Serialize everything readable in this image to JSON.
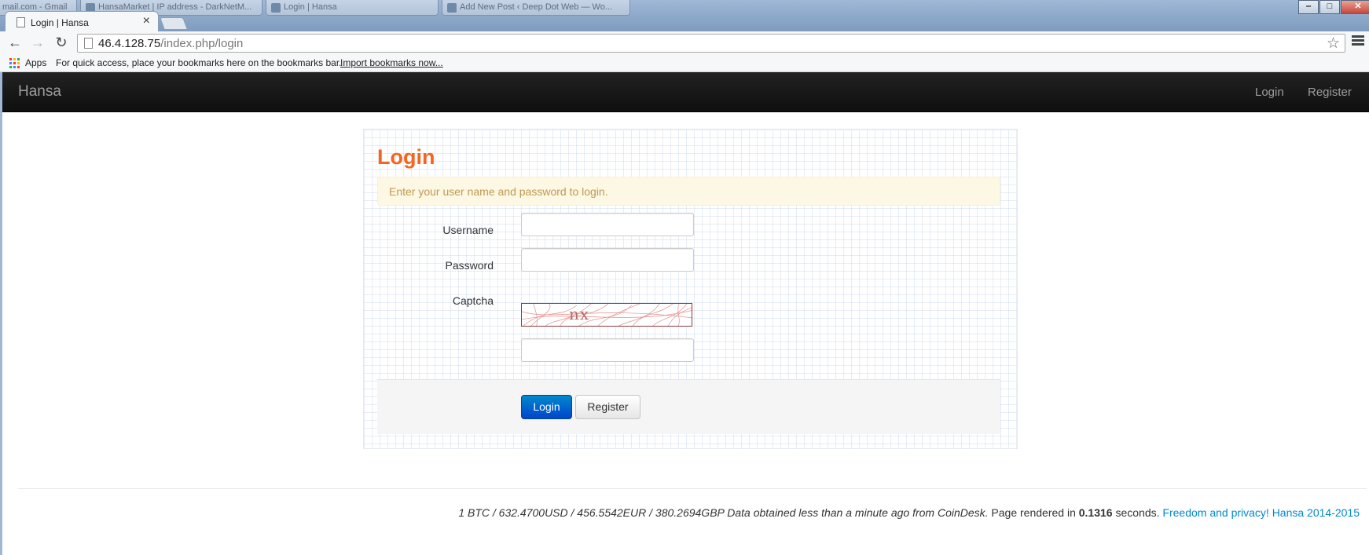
{
  "browser": {
    "background_tabs": [
      "mail.com - Gmail",
      "HansaMarket | IP address - DarkNetM...",
      "Login | Hansa",
      "Add New Post ‹ Deep Dot Web — Wo..."
    ],
    "active_tab": {
      "title": "Login | Hansa",
      "close_glyph": "×"
    },
    "window_controls": {
      "minimize": "‒",
      "maximize": "□",
      "close": "✕"
    },
    "nav": {
      "back": "←",
      "forward": "→",
      "reload": "↻"
    },
    "address": {
      "host": "46.4.128.75",
      "path": "/index.php/login"
    },
    "bookmarks_bar": {
      "apps_label": "Apps",
      "hint": "For quick access, place your bookmarks here on the bookmarks bar.",
      "import_link": "Import bookmarks now..."
    }
  },
  "navbar": {
    "brand": "Hansa",
    "links": [
      {
        "label": "Login"
      },
      {
        "label": "Register"
      }
    ]
  },
  "login": {
    "heading": "Login",
    "alert": "Enter your user name and password to login.",
    "fields": {
      "username_label": "Username",
      "username_value": "",
      "password_label": "Password",
      "password_value": "",
      "captcha_label": "Captcha",
      "captcha_image_text": "nx",
      "captcha_value": ""
    },
    "buttons": {
      "login": "Login",
      "register": "Register"
    }
  },
  "footer": {
    "rates": "1 BTC / 632.4700USD / 456.5542EUR / 380.2694GBP Data obtained less than a minute ago from CoinDesk.",
    "rendered_prefix": " Page rendered in ",
    "rendered_time": "0.1316",
    "rendered_suffix": " seconds. ",
    "link": "Freedom and privacy! Hansa 2014-2015"
  },
  "colors": {
    "heading": "#f26522",
    "navbar": "#1b1b1b",
    "primary_button": "#0055cc",
    "alert_bg": "#fcf8e3",
    "alert_text": "#c09853",
    "link": "#0088cc"
  },
  "icons": [
    "page-icon",
    "close-icon",
    "back-icon",
    "forward-icon",
    "reload-icon",
    "star-icon",
    "menu-icon",
    "apps-icon"
  ]
}
